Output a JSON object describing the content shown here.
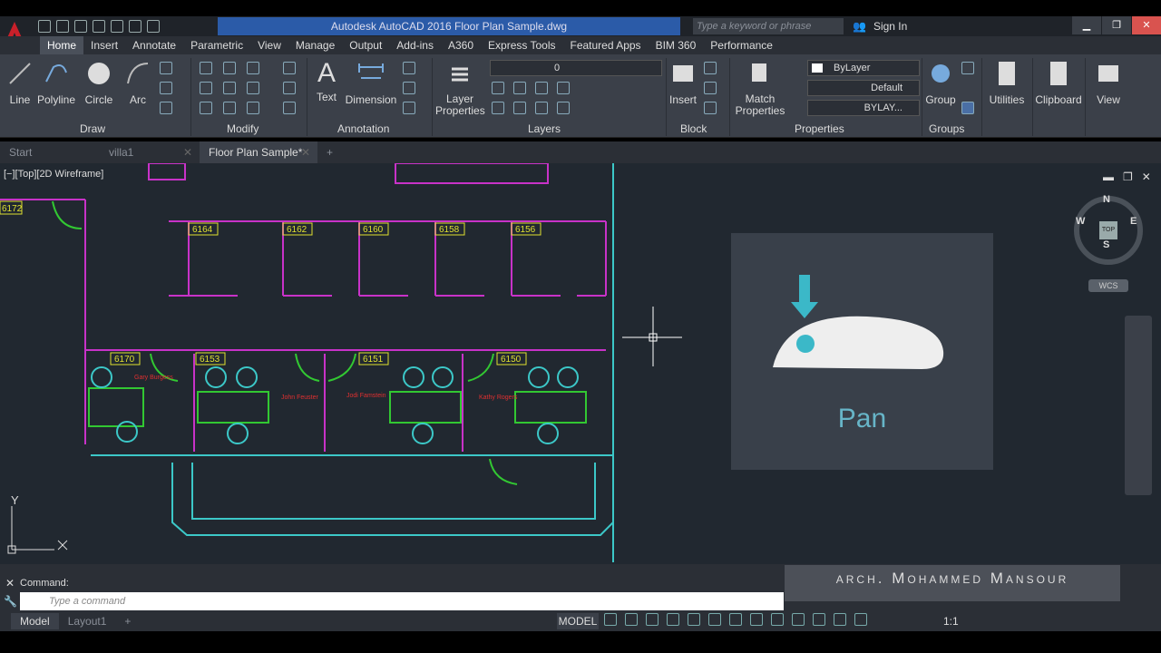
{
  "title": "Autodesk AutoCAD 2016    Floor Plan Sample.dwg",
  "search_placeholder": "Type a keyword or phrase",
  "signin": "Sign In",
  "ribbon_tabs": [
    "Home",
    "Insert",
    "Annotate",
    "Parametric",
    "View",
    "Manage",
    "Output",
    "Add-ins",
    "A360",
    "Express Tools",
    "Featured Apps",
    "BIM 360",
    "Performance"
  ],
  "draw": {
    "line": "Line",
    "polyline": "Polyline",
    "circle": "Circle",
    "arc": "Arc",
    "panel": "Draw"
  },
  "modify": {
    "panel": "Modify"
  },
  "annotation": {
    "text": "Text",
    "dimension": "Dimension",
    "panel": "Annotation"
  },
  "layers": {
    "layer_properties": "Layer\nProperties",
    "panel": "Layers",
    "current": "0"
  },
  "block": {
    "insert": "Insert",
    "panel": "Block"
  },
  "properties": {
    "match": "Match\nProperties",
    "color": "ByLayer",
    "linetype": "Default",
    "lineweight": "BYLAY...",
    "panel": "Properties"
  },
  "groups": {
    "group": "Group",
    "panel": "Groups"
  },
  "utilities": "Utilities",
  "clipboard": "Clipboard",
  "view": "View",
  "file_tabs": {
    "start": "Start",
    "villa": "villa1",
    "active": "Floor Plan Sample*"
  },
  "viewport_label": "[−][Top][2D Wireframe]",
  "rooms": [
    "6172",
    "6164",
    "6162",
    "6160",
    "6158",
    "6156",
    "6170",
    "6153",
    "6151",
    "6150"
  ],
  "people": {
    "p1": "Gary\nBurgess",
    "p2": "John\nFeuster",
    "p3": "Jodi\nFamstein",
    "p4": "Kathy\nRogers"
  },
  "pan_label": "Pan",
  "watermark": "arch. Mohammed Mansour",
  "command_history": "Command:",
  "command_placeholder": "Type a command",
  "layout_tabs": {
    "model": "Model",
    "layout1": "Layout1"
  },
  "status": {
    "model": "MODEL",
    "scale": "1:1"
  },
  "compass": {
    "n": "N",
    "s": "S",
    "e": "E",
    "w": "W",
    "top": "TOP",
    "wcs": "WCS"
  },
  "ucs": {
    "x": "X",
    "y": "Y"
  }
}
